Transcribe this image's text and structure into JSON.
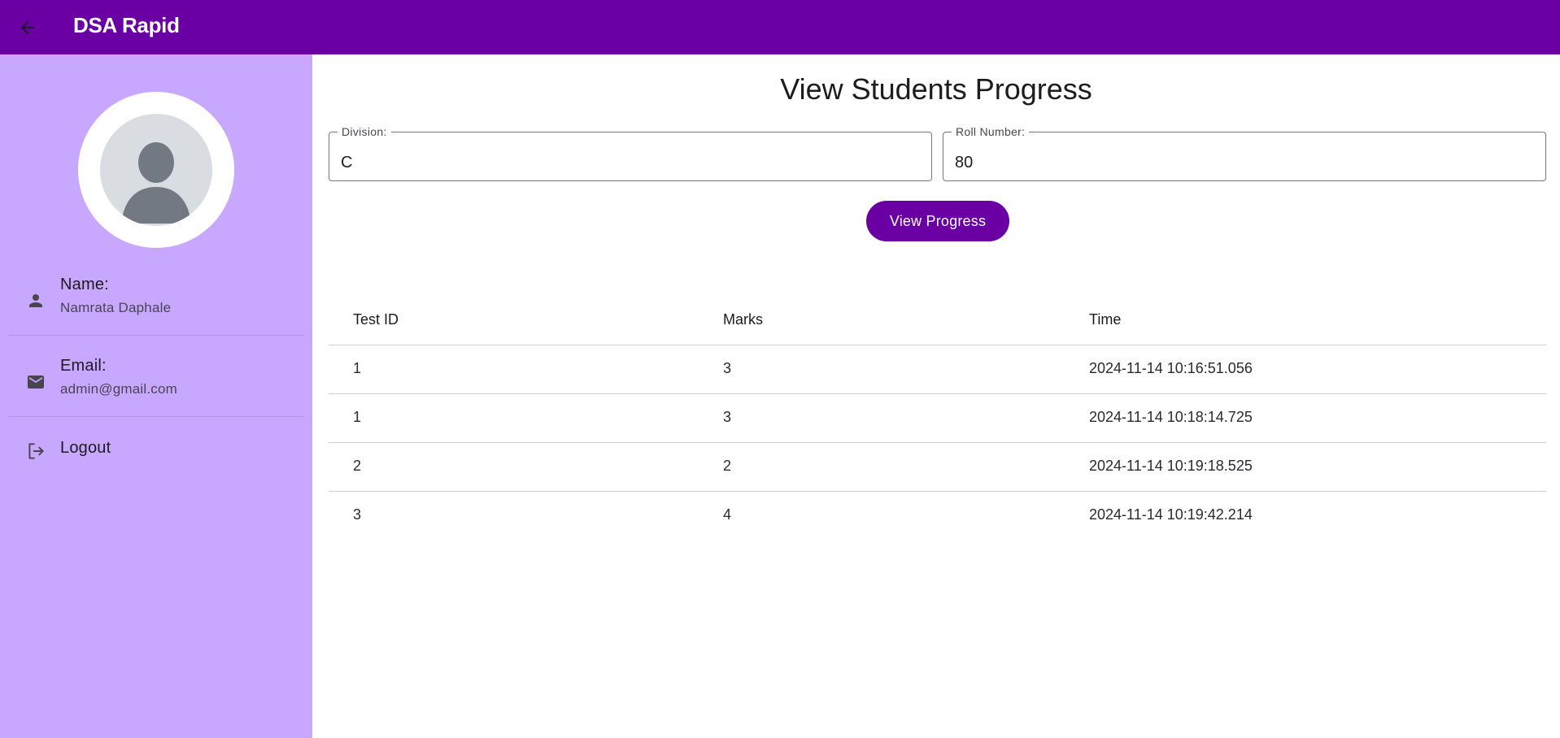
{
  "appbar": {
    "title": "DSA Rapid",
    "back_icon": "arrow-back-icon",
    "color": "#6a00a4"
  },
  "sidebar": {
    "background": "#c8a8ff",
    "avatar_icon": "person-avatar-icon",
    "name": {
      "icon": "person-icon",
      "label": "Name:",
      "value": "Namrata Daphale"
    },
    "email": {
      "icon": "mail-icon",
      "label": "Email:",
      "value": "admin@gmail.com"
    },
    "logout": {
      "icon": "logout-icon",
      "label": "Logout"
    }
  },
  "main": {
    "title": "View Students Progress",
    "division": {
      "label": "Division:",
      "value": "C"
    },
    "roll_number": {
      "label": "Roll Number:",
      "value": "80"
    },
    "view_button": "View Progress",
    "table": {
      "headers": [
        "Test ID",
        "Marks",
        "Time"
      ],
      "rows": [
        [
          "1",
          "3",
          "2024-11-14 10:16:51.056"
        ],
        [
          "1",
          "3",
          "2024-11-14 10:18:14.725"
        ],
        [
          "2",
          "2",
          "2024-11-14 10:19:18.525"
        ],
        [
          "3",
          "4",
          "2024-11-14 10:19:42.214"
        ]
      ]
    }
  }
}
